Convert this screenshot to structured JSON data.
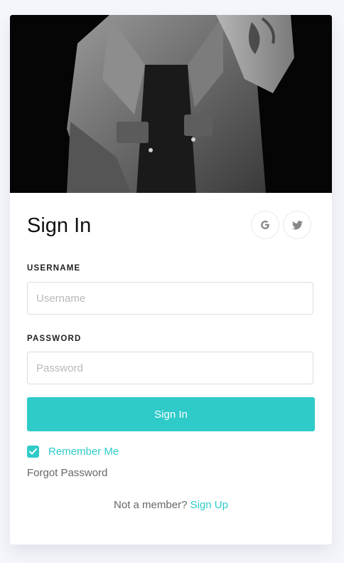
{
  "signin": {
    "title": "Sign In",
    "social": [
      {
        "name": "google",
        "icon": "google-icon"
      },
      {
        "name": "twitter",
        "icon": "twitter-icon"
      }
    ],
    "username": {
      "label": "USERNAME",
      "placeholder": "Username",
      "value": ""
    },
    "password": {
      "label": "PASSWORD",
      "placeholder": "Password",
      "value": ""
    },
    "button_label": "Sign In",
    "remember_me": {
      "label": "Remember Me",
      "checked": true
    },
    "forgot_password": "Forgot Password",
    "signup_prompt": "Not a member?",
    "signup_link": "Sign Up"
  },
  "colors": {
    "accent": "#2ecbc9",
    "background": "#f4f6fb",
    "card": "#ffffff"
  },
  "hero_image": {
    "description_icon": "person-in-denim-jacket-photo"
  }
}
